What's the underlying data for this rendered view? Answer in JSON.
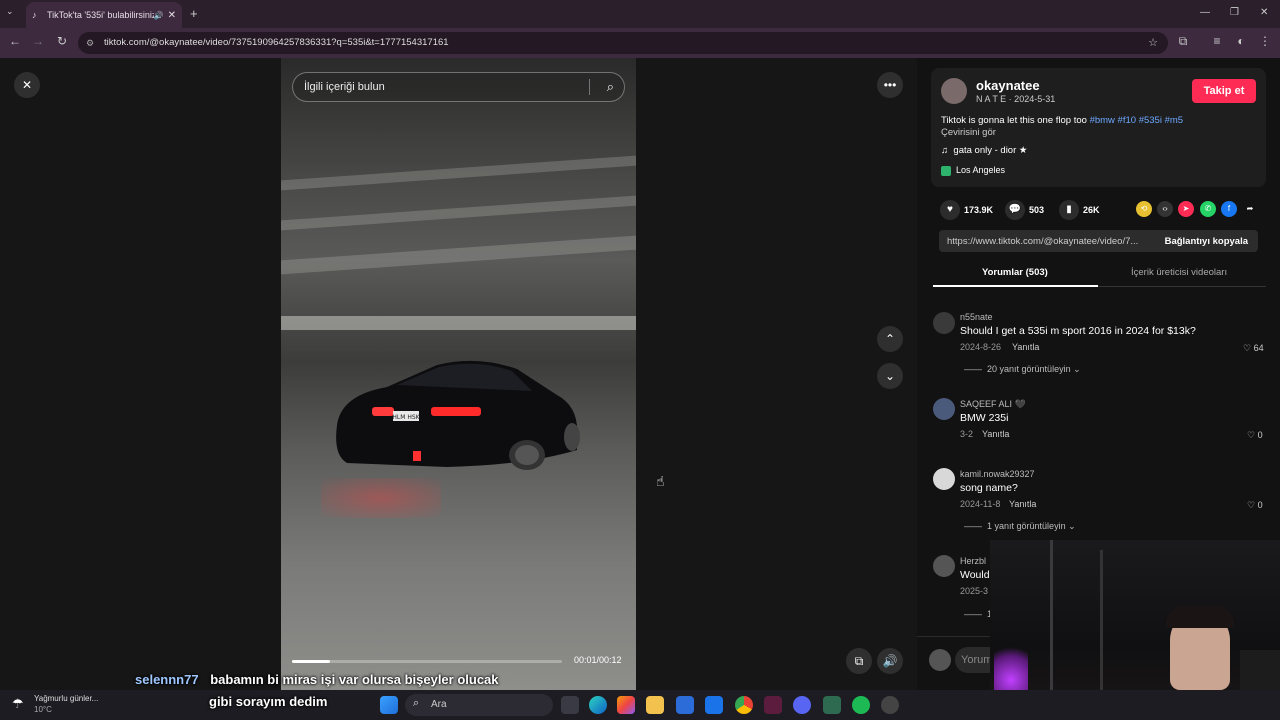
{
  "browser": {
    "tab_title": "TikTok'ta '535i' bulabilirsiniz",
    "url": "tiktok.com/@okaynatee/video/7375190964257836331?q=535i&t=1777154317161"
  },
  "video": {
    "search_placeholder": "İlgili içeriği bulun",
    "time": "00:01/00:12",
    "progress": 0.14,
    "plate": "HLM HSK"
  },
  "author": {
    "username": "okaynatee",
    "nickname_date": "N A T E · 2024-5-31",
    "follow_label": "Takip et",
    "caption": "Tiktok is gonna let this one flop too",
    "hashtags": "#bmw #f10 #535i #m5",
    "translate": "Çevirisini gör",
    "music": "gata only - dior ★",
    "location": "Los Angeles"
  },
  "stats": {
    "likes": "173.9K",
    "comments": "503",
    "saves": "26K"
  },
  "link": {
    "url": "https://www.tiktok.com/@okaynatee/video/7...",
    "copy_label": "Bağlantıyı kopyala"
  },
  "tabs": {
    "comments": "Yorumlar (503)",
    "creator_videos": "İçerik üreticisi videoları"
  },
  "comments": [
    {
      "name": "n55nate",
      "text": "Should I get a 535i m sport 2016 in 2024 for $13k?",
      "date": "2024-8-26",
      "reply": "Yanıtla",
      "likes": "64",
      "replies": "20 yanıt görüntüleyin"
    },
    {
      "name": "SAQEEF ALI 🖤",
      "text": "BMW 235i",
      "date": "3-2",
      "reply": "Yanıtla",
      "likes": "0",
      "replies": ""
    },
    {
      "name": "kamil.nowak29327",
      "text": "song name?",
      "date": "2024-11-8",
      "reply": "Yanıtla",
      "likes": "0",
      "replies": "1 yanıt görüntüleyin"
    },
    {
      "name": "Herzbl",
      "text": "Would",
      "date": "2025-3",
      "reply": "",
      "likes": "",
      "replies": "1"
    }
  ],
  "comment_input_placeholder": "Yorum",
  "chat": {
    "user": "selennn77",
    "line1": "babamın bi miras işi var olursa bişeyler olucak",
    "line2": "gibi sorayım dedim"
  },
  "taskbar": {
    "weather_text": "Yağmurlu günler...",
    "temperature": "10°C",
    "search_label": "Ara"
  }
}
